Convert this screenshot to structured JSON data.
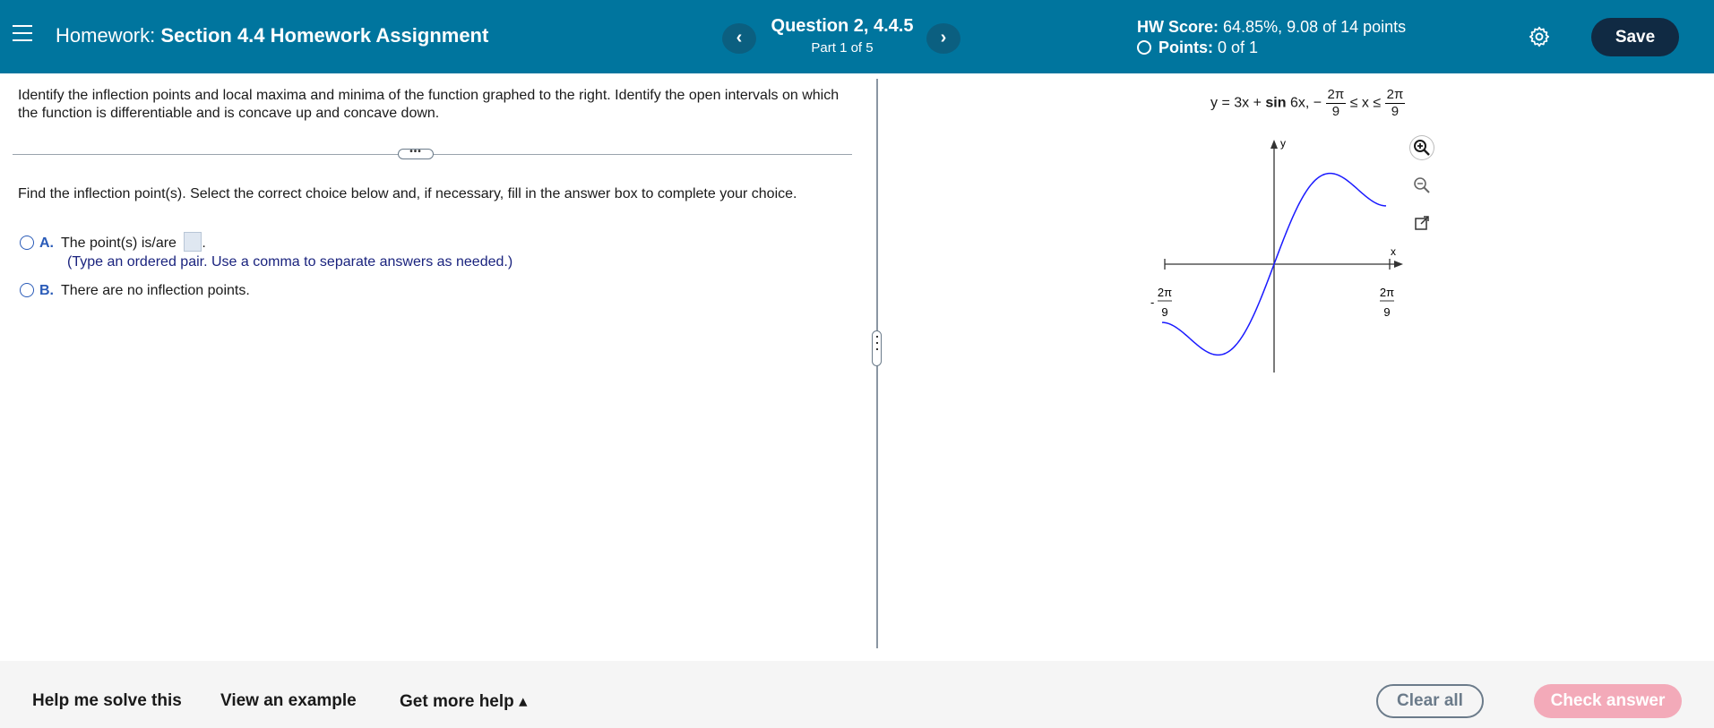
{
  "header": {
    "homework_prefix": "Homework:",
    "homework_title": "Section 4.4 Homework Assignment",
    "prev_label": "‹",
    "next_label": "›",
    "question_title": "Question 2, 4.4.5",
    "question_part": "Part 1 of 5",
    "hw_score_label": "HW Score:",
    "hw_score_value": "64.85%, 9.08 of 14 points",
    "points_label": "Points:",
    "points_value": "0 of 1",
    "save_label": "Save"
  },
  "problem": {
    "intro": "Identify the inflection points and local maxima and minima of the function graphed to the right. Identify the open intervals on which the function is differentiable and is concave up and concave down.",
    "ellipsis": "•••",
    "question": "Find the inflection point(s). Select the correct choice below and, if necessary, fill in the answer box to complete your choice.",
    "choices": [
      {
        "letter": "A.",
        "text": "The point(s) is/are",
        "suffix": "."
      },
      {
        "letter": "B.",
        "text": "There are no inflection points."
      }
    ],
    "hint": "(Type an ordered pair. Use a comma to separate answers as needed.)"
  },
  "graph": {
    "equation_left": "y = 3x +",
    "equation_sin": "sin",
    "equation_right": "6x,",
    "neg_sign": "−",
    "bound_num": "2π",
    "bound_den": "9",
    "le_x_le": "≤ x ≤",
    "x_axis_label": "x",
    "y_axis_label": "y",
    "left_tick_sign": "-",
    "left_tick_num": "2π",
    "left_tick_den": "9",
    "right_tick_num": "2π",
    "right_tick_den": "9",
    "curve_color": "#1a1aff",
    "function": "3x + sin 6x",
    "domain": [
      "-2π/9",
      "2π/9"
    ],
    "tools": [
      "zoom-in-icon",
      "zoom-out-icon",
      "pop-out-icon"
    ]
  },
  "footer": {
    "help_solve": "Help me solve this",
    "view_example": "View an example",
    "more_help": "Get more help ▴",
    "clear_all": "Clear all",
    "check_answer": "Check answer"
  }
}
